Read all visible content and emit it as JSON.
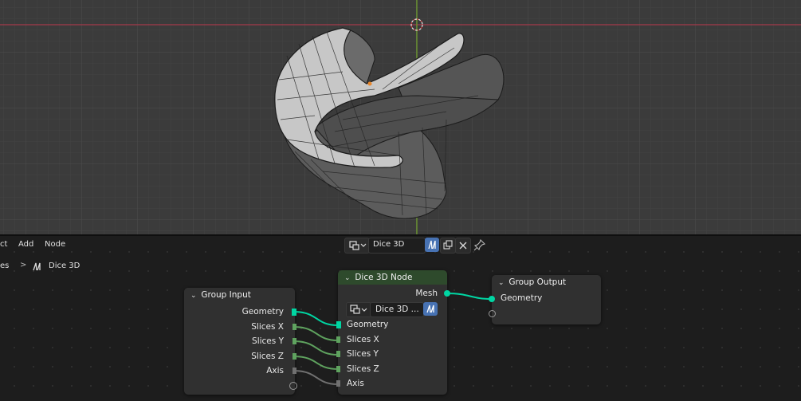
{
  "menu": {
    "select_fragment": "ct",
    "add": "Add",
    "node": "Node"
  },
  "header": {
    "node_tree_name": "Dice 3D"
  },
  "breadcrumb": {
    "first_fragment": "es",
    "separator": ">",
    "current": "Dice 3D"
  },
  "nodes": {
    "group_input": {
      "title": "Group Input",
      "outputs": [
        "Geometry",
        "Slices X",
        "Slices Y",
        "Slices Z",
        "Axis"
      ]
    },
    "dice_node": {
      "title": "Dice 3D Node",
      "output": "Mesh",
      "group_selector": "Dice 3D ...",
      "inputs": [
        "Geometry",
        "Slices X",
        "Slices Y",
        "Slices Z",
        "Axis"
      ]
    },
    "group_output": {
      "title": "Group Output",
      "inputs": [
        "Geometry"
      ]
    }
  },
  "colors": {
    "geometry_socket": "#00d6a3",
    "float_socket": "#5fa35f",
    "int_socket": "#5fa35f",
    "axis_socket": "#707070",
    "node_header_green": "#2e4a2c",
    "node_body": "#303030",
    "x_axis": "#b0404f",
    "y_axis": "#6ea22a",
    "accent_blue": "#4772b3"
  }
}
